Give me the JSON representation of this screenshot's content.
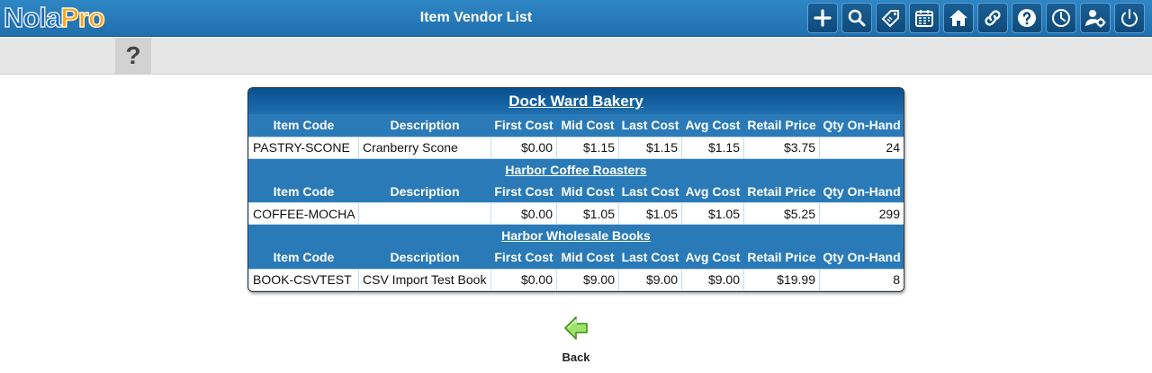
{
  "app": {
    "logo_left": "Nola",
    "logo_right": "Pro",
    "title": "Item Vendor List"
  },
  "toolbar": {
    "buttons": [
      {
        "name": "add-icon"
      },
      {
        "name": "search-icon"
      },
      {
        "name": "tag-icon"
      },
      {
        "name": "calendar-icon"
      },
      {
        "name": "home-icon"
      },
      {
        "name": "link-icon"
      },
      {
        "name": "help-icon"
      },
      {
        "name": "clock-icon"
      },
      {
        "name": "user-settings-icon"
      },
      {
        "name": "power-icon"
      }
    ]
  },
  "subbar": {
    "help_label": "?"
  },
  "columns": [
    "Item Code",
    "Description",
    "First Cost",
    "Mid Cost",
    "Last Cost",
    "Avg Cost",
    "Retail Price",
    "Qty On-Hand"
  ],
  "vendors": [
    {
      "name": "Dock Ward Bakery",
      "rows": [
        {
          "item_code": "PASTRY-SCONE",
          "description": "Cranberry Scone",
          "first_cost": "$0.00",
          "mid_cost": "$1.15",
          "last_cost": "$1.15",
          "avg_cost": "$1.15",
          "retail_price": "$3.75",
          "qty": "24"
        }
      ]
    },
    {
      "name": "Harbor Coffee Roasters",
      "rows": [
        {
          "item_code": "COFFEE-MOCHA",
          "description": "",
          "first_cost": "$0.00",
          "mid_cost": "$1.05",
          "last_cost": "$1.05",
          "avg_cost": "$1.05",
          "retail_price": "$5.25",
          "qty": "299"
        }
      ]
    },
    {
      "name": "Harbor Wholesale Books",
      "rows": [
        {
          "item_code": "BOOK-CSVTEST",
          "description": "CSV Import Test Book",
          "first_cost": "$0.00",
          "mid_cost": "$9.00",
          "last_cost": "$9.00",
          "avg_cost": "$9.00",
          "retail_price": "$19.99",
          "qty": "8"
        }
      ]
    }
  ],
  "footer": {
    "back_label": "Back"
  },
  "colors": {
    "header_blue": "#2a7ab8",
    "title_blue": "#084f8e",
    "back_arrow": "#7cc63c"
  }
}
